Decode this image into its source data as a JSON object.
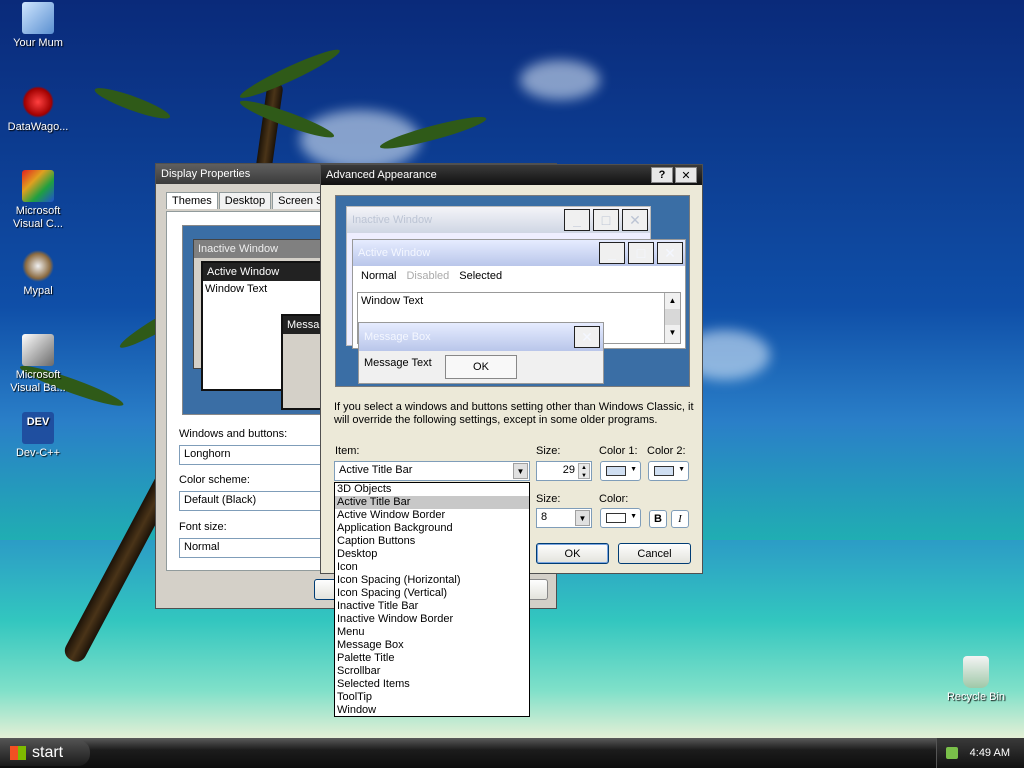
{
  "desktop": {
    "icons": [
      {
        "label": "Your Mum"
      },
      {
        "label": "DataWago..."
      },
      {
        "label": "Microsoft Visual C..."
      },
      {
        "label": "Mypal"
      },
      {
        "label": "Microsoft Visual Ba..."
      },
      {
        "label": "Dev-C++"
      },
      {
        "label": "Recycle Bin"
      }
    ],
    "dev_icon_text": "DEV"
  },
  "display_properties": {
    "title": "Display Properties",
    "tabs": [
      "Themes",
      "Desktop",
      "Screen Sa"
    ],
    "preview": {
      "inactive_title": "Inactive Window",
      "active_title": "Active Window",
      "window_text": "Window Text",
      "message_title": "Messa"
    },
    "windows_buttons_label": "Windows and buttons:",
    "windows_buttons_value": "Longhorn",
    "color_scheme_label": "Color scheme:",
    "color_scheme_value": "Default (Black)",
    "font_size_label": "Font size:",
    "font_size_value": "Normal"
  },
  "advanced": {
    "title": "Advanced Appearance",
    "help_btn": "?",
    "close_btn": "✕",
    "preview": {
      "inactive_title": "Inactive Window",
      "active_title": "Active Window",
      "menu": [
        "Normal",
        "Disabled",
        "Selected"
      ],
      "window_text": "Window Text",
      "message_title": "Message Box",
      "message_text": "Message Text",
      "ok": "OK"
    },
    "info_text": "If you select a windows and buttons setting other than Windows Classic, it will override the following settings, except in some older programs.",
    "item_label": "Item:",
    "item_value": "Active Title Bar",
    "size_label": "Size:",
    "size_value": "29",
    "color1_label": "Color 1:",
    "color2_label": "Color 2:",
    "font_size_label": "Size:",
    "font_size_value": "8",
    "font_color_label": "Color:",
    "bold_label": "B",
    "italic_label": "I",
    "ok": "OK",
    "cancel": "Cancel",
    "dropdown_items": [
      "3D Objects",
      "Active Title Bar",
      "Active Window Border",
      "Application Background",
      "Caption Buttons",
      "Desktop",
      "Icon",
      "Icon Spacing (Horizontal)",
      "Icon Spacing (Vertical)",
      "Inactive Title Bar",
      "Inactive Window Border",
      "Menu",
      "Message Box",
      "Palette Title",
      "Scrollbar",
      "Selected Items",
      "ToolTip",
      "Window"
    ],
    "selected_index": 1
  },
  "taskbar": {
    "start_label": "start",
    "clock": "4:49 AM"
  }
}
